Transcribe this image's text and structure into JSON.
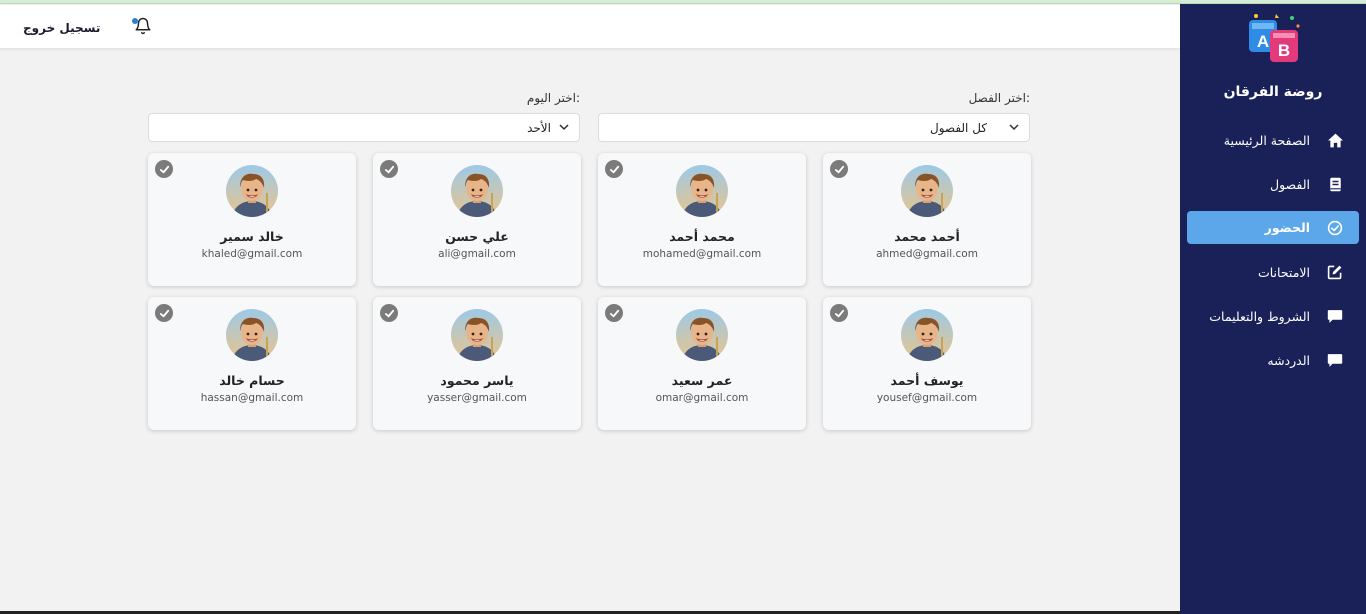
{
  "app": {
    "brand": "روضة الفرقان"
  },
  "header": {
    "logout_label": "تسجيل خروج"
  },
  "sidebar": {
    "items": [
      {
        "label": "الصفحة الرئيسية",
        "icon": "home-icon"
      },
      {
        "label": "الفصول",
        "icon": "book-icon"
      },
      {
        "label": "الحضور",
        "icon": "check-circle-icon",
        "active": true
      },
      {
        "label": "الامتحانات",
        "icon": "edit-icon"
      },
      {
        "label": "الشروط والتعليمات",
        "icon": "comment-icon"
      },
      {
        "label": "الدردشه",
        "icon": "chat-icon"
      }
    ]
  },
  "filters": {
    "class_label": "اختر الفصل:",
    "class_value": "كل الفصول",
    "day_label": "اختر اليوم:",
    "day_value": "الأحد"
  },
  "students": [
    {
      "name": "أحمد محمد",
      "email": "ahmed@gmail.com"
    },
    {
      "name": "محمد أحمد",
      "email": "mohamed@gmail.com"
    },
    {
      "name": "علي حسن",
      "email": "ali@gmail.com"
    },
    {
      "name": "خالد سمير",
      "email": "khaled@gmail.com"
    },
    {
      "name": "يوسف أحمد",
      "email": "yousef@gmail.com"
    },
    {
      "name": "عمر سعيد",
      "email": "omar@gmail.com"
    },
    {
      "name": "ياسر محمود",
      "email": "yasser@gmail.com"
    },
    {
      "name": "حسام خالد",
      "email": "hassan@gmail.com"
    }
  ],
  "colors": {
    "sidebar": "#1a2158",
    "active": "#5ca7ea",
    "background": "#f2f2f2"
  }
}
